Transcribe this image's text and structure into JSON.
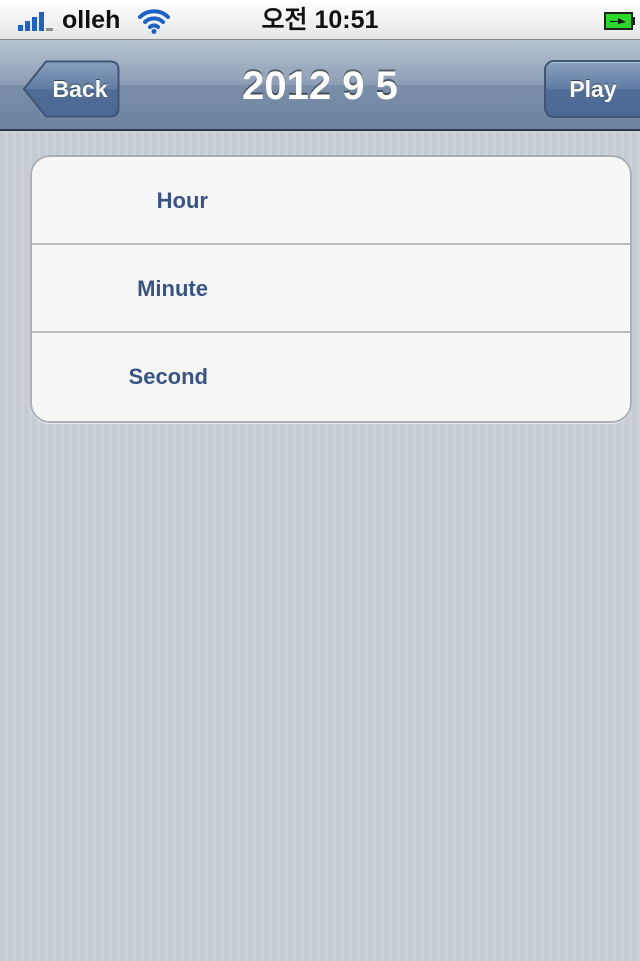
{
  "status_bar": {
    "carrier": "olleh",
    "time": "오전 10:51",
    "signal_bars_active": 4,
    "icons": [
      "signal-icon",
      "wifi-icon",
      "battery-charging-icon"
    ]
  },
  "nav_bar": {
    "title": "2012 9 5",
    "back_label": "Back",
    "play_label": "Play"
  },
  "table": {
    "rows": [
      {
        "label": "Hour"
      },
      {
        "label": "Minute"
      },
      {
        "label": "Second"
      }
    ]
  },
  "colors": {
    "nav_bar": "#7a8ea8",
    "row_label": "#385487",
    "background": "#c5ccd4",
    "signal": "#1b62c9",
    "battery": "#2bd92b"
  }
}
